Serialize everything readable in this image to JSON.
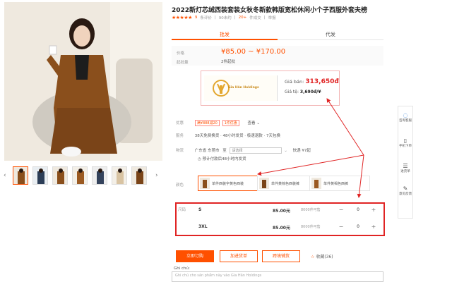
{
  "product": {
    "title": "2022新灯芯绒西装套装女秋冬新款韩版宽松休闲小个子西服外套夫榜",
    "rating": "9",
    "review_label": "条评价",
    "buyers": "90未约",
    "sales_count": "20+",
    "sales_label": "件成交",
    "report_label": "举报"
  },
  "tabs": [
    {
      "label": "批发"
    },
    {
      "label": "代发"
    }
  ],
  "price": {
    "label": "价格",
    "range": "¥85.00 ~ ¥170.00",
    "sold_label": "起批量",
    "sold_value": "2件起批"
  },
  "exchange": {
    "logo_text": "Gia Hân Holdings",
    "sell_label": "Giá bán:",
    "sell_value": "313,650đ",
    "rate_label": "Giá tệ:",
    "rate_value": "3,690đ/¥"
  },
  "services": {
    "label": "优惠",
    "tag1": "满¥888减20",
    "tag2": "1件优惠",
    "more": "查看",
    "ship_label": "服务",
    "ship_value": "38天免费换货 · 48小时发货 · 极速退款 · 7天包换",
    "logistics_label": "物流",
    "from": "广东省 东莞市",
    "to_prefix": "至",
    "select_placeholder": "请选择",
    "freight": "快递 ¥7起",
    "delivery": "预计付款后48小时内发货"
  },
  "colors": {
    "label": "颜色",
    "options": [
      {
        "text": "单件西装字黄色西装"
      },
      {
        "text": "单件黄棕色西装裤"
      },
      {
        "text": "单件黄褐色西裤"
      }
    ]
  },
  "sizes": {
    "label": "尺码",
    "rows": [
      {
        "name": "S",
        "price": "85.00元",
        "stock": "8000件可售",
        "qty": "0"
      },
      {
        "name": "3XL",
        "price": "85.00元",
        "stock": "8000件可售",
        "qty": "0"
      }
    ]
  },
  "actions": {
    "order": "立即订购",
    "cart": "加进货单",
    "dropship": "跨境铺货",
    "favorite": "收藏(36)"
  },
  "note": {
    "label": "Ghi chú:",
    "placeholder": "Ghi chú cho sản phẩm này vào Gia Hân Holdings"
  },
  "toolbar": [
    {
      "icon": "chat-icon",
      "label": "咨询客服"
    },
    {
      "icon": "phone-icon",
      "label": "手机下单"
    },
    {
      "icon": "list-icon",
      "label": "进货单"
    },
    {
      "icon": "edit-icon",
      "label": "意见反馈"
    }
  ],
  "colors_theme": {
    "accent": "#ff5000",
    "annotation": "#e02424"
  }
}
